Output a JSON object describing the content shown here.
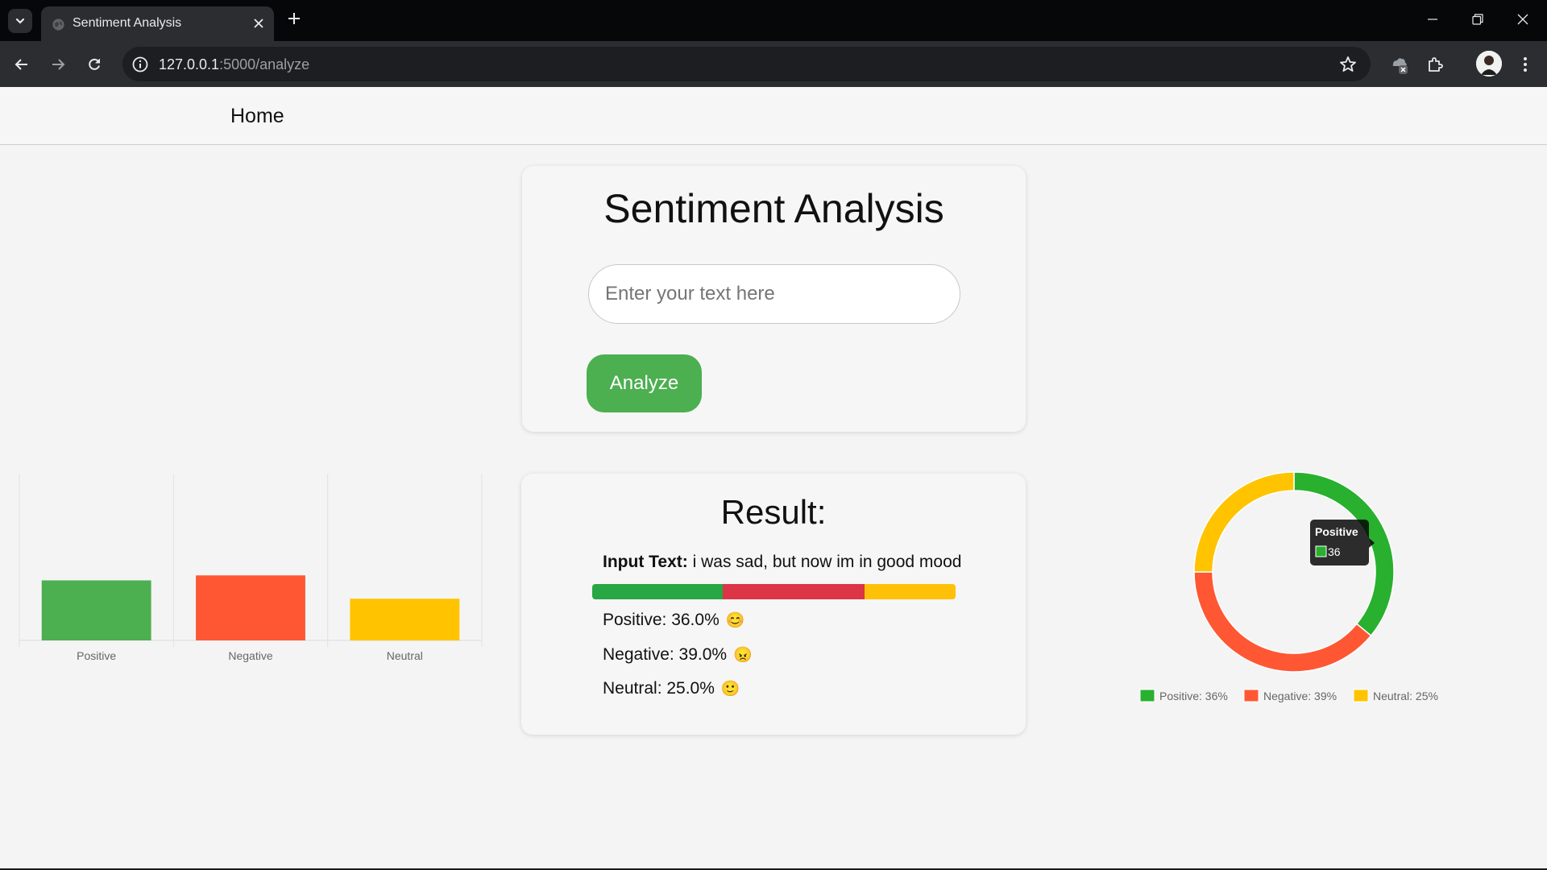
{
  "browser": {
    "tab_title": "Sentiment Analysis",
    "url_host": "127.0.0.1",
    "url_rest": ":5000/analyze"
  },
  "nav": {
    "home": "Home"
  },
  "form": {
    "title": "Sentiment Analysis",
    "input_placeholder": "Enter your text here",
    "input_value": "",
    "analyze_label": "Analyze"
  },
  "result": {
    "title": "Result:",
    "input_label": "Input Text:",
    "input_text": "i was sad, but now im in good mood",
    "bar_colors": [
      "#28a745",
      "#dc3545",
      "#ffc107"
    ],
    "lines": [
      {
        "label": "Positive: 36.0%",
        "value": 36,
        "emoji": "😊"
      },
      {
        "label": "Negative: 39.0%",
        "value": 39,
        "emoji": "😠"
      },
      {
        "label": "Neutral: 25.0%",
        "value": 25,
        "emoji": "🙂"
      }
    ]
  },
  "chart_data": [
    {
      "type": "bar",
      "categories": [
        "Positive",
        "Negative",
        "Neutral"
      ],
      "values": [
        36,
        39,
        25
      ],
      "colors": [
        "#4caf50",
        "#ff5733",
        "#ffc300"
      ],
      "ylim": [
        0,
        100
      ],
      "grid": true
    },
    {
      "type": "pie",
      "variant": "doughnut",
      "categories": [
        "Positive",
        "Negative",
        "Neutral"
      ],
      "values": [
        36,
        39,
        25
      ],
      "colors": [
        "#28b02e",
        "#ff5733",
        "#ffc300"
      ],
      "legend": [
        "Positive: 36%",
        "Negative: 39%",
        "Neutral: 25%"
      ],
      "legend_position": "bottom",
      "tooltip": {
        "title": "Positive",
        "value": "36"
      }
    }
  ]
}
